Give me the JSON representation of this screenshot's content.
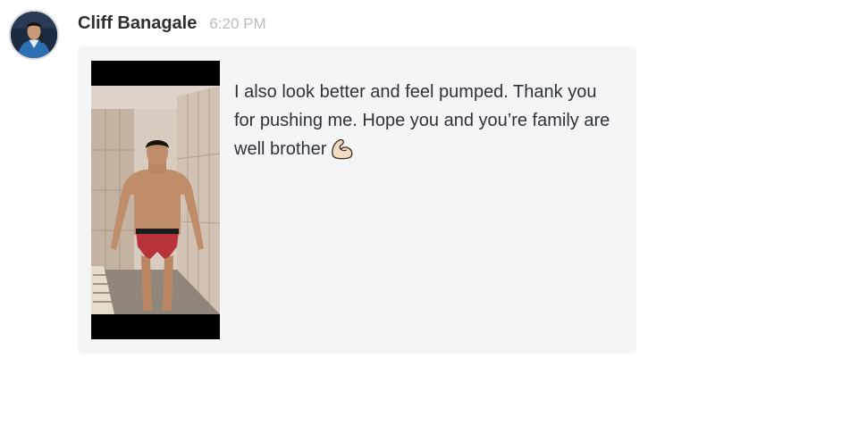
{
  "message": {
    "sender_name": "Cliff Banagale",
    "timestamp": "6:20 PM",
    "text": "I also look better and feel pumped. Thank you for pushing me. Hope you and you’re family are well brother",
    "emoji": "flexed-biceps",
    "avatar_icon": "user-avatar",
    "attachment_icon": "photo-attachment"
  },
  "colors": {
    "bubble_background": "#f3f5f7",
    "sender_text": "#2d2f33",
    "timestamp_text": "#b9bcc0",
    "message_text": "#2f3236"
  }
}
